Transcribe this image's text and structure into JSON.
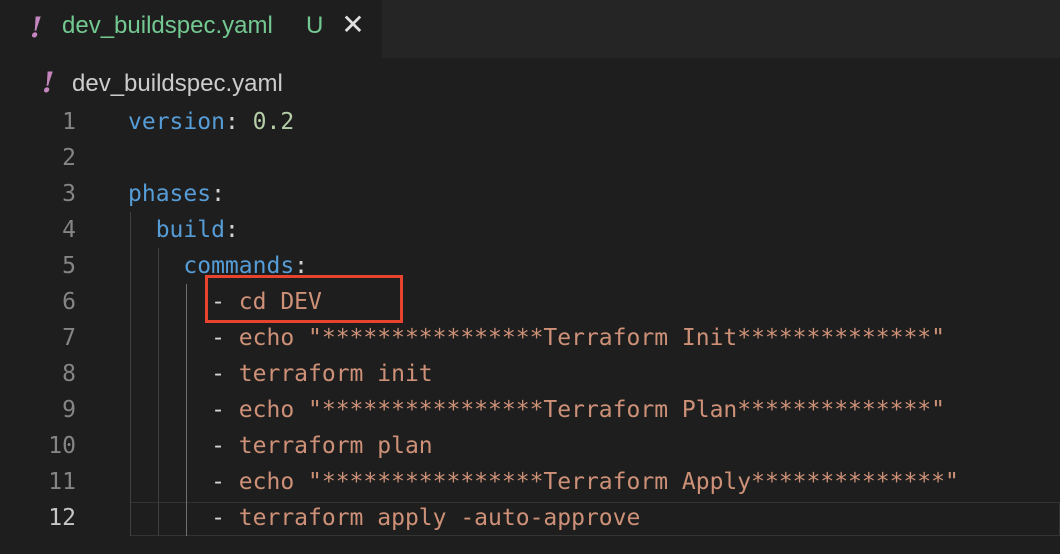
{
  "tab": {
    "icon": "!",
    "title": "dev_buildspec.yaml",
    "badge": "U",
    "close": "✕"
  },
  "breadcrumb": {
    "icon": "!",
    "text": "dev_buildspec.yaml"
  },
  "lines": [
    {
      "n": "1",
      "segments": [
        {
          "t": "version",
          "c": "key"
        },
        {
          "t": ": ",
          "c": "punc"
        },
        {
          "t": "0.2",
          "c": "num"
        }
      ]
    },
    {
      "n": "2",
      "segments": []
    },
    {
      "n": "3",
      "segments": [
        {
          "t": "phases",
          "c": "key"
        },
        {
          "t": ":",
          "c": "punc"
        }
      ]
    },
    {
      "n": "4",
      "segments": [
        {
          "t": "  build",
          "c": "key"
        },
        {
          "t": ":",
          "c": "punc"
        }
      ]
    },
    {
      "n": "5",
      "segments": [
        {
          "t": "    commands",
          "c": "key"
        },
        {
          "t": ":",
          "c": "punc"
        }
      ]
    },
    {
      "n": "6",
      "segments": [
        {
          "t": "      - ",
          "c": "punc"
        },
        {
          "t": "cd DEV",
          "c": "str"
        }
      ]
    },
    {
      "n": "7",
      "segments": [
        {
          "t": "      - ",
          "c": "punc"
        },
        {
          "t": "echo \"****************Terraform Init**************\"",
          "c": "str"
        }
      ]
    },
    {
      "n": "8",
      "segments": [
        {
          "t": "      - ",
          "c": "punc"
        },
        {
          "t": "terraform init",
          "c": "str"
        }
      ]
    },
    {
      "n": "9",
      "segments": [
        {
          "t": "      - ",
          "c": "punc"
        },
        {
          "t": "echo \"****************Terraform Plan**************\"",
          "c": "str"
        }
      ]
    },
    {
      "n": "10",
      "segments": [
        {
          "t": "      - ",
          "c": "punc"
        },
        {
          "t": "terraform plan",
          "c": "str"
        }
      ]
    },
    {
      "n": "11",
      "segments": [
        {
          "t": "      - ",
          "c": "punc"
        },
        {
          "t": "echo \"****************Terraform Apply**************\"",
          "c": "str"
        }
      ]
    },
    {
      "n": "12",
      "segments": [
        {
          "t": "      - ",
          "c": "punc"
        },
        {
          "t": "terraform apply -auto-approve",
          "c": "str"
        }
      ]
    }
  ],
  "active_line": "12",
  "colors": {
    "key": "#569cd6",
    "number": "#b5cea8",
    "string": "#ce9178",
    "highlight": "#e8432c",
    "modified": "#73c991"
  }
}
